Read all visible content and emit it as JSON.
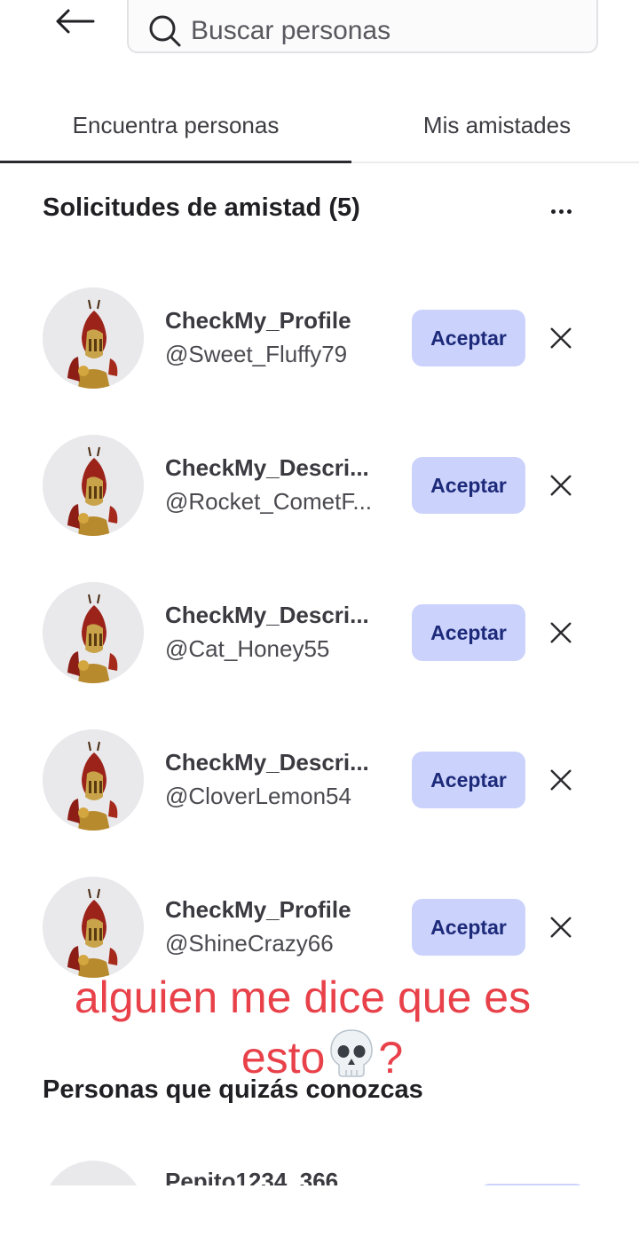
{
  "header": {
    "back_icon": "arrow-left-icon",
    "search": {
      "icon": "search-icon",
      "placeholder": "Buscar personas",
      "value": ""
    }
  },
  "tabs": [
    {
      "label": "Encuentra personas",
      "active": true
    },
    {
      "label": "Mis amistades",
      "active": false
    }
  ],
  "requests": {
    "title": "Solicitudes de amistad (5)",
    "more_icon": "more-horizontal-icon",
    "accept_label": "Aceptar",
    "dismiss_icon": "close-icon",
    "items": [
      {
        "name": "CheckMy_Profile",
        "handle": "@Sweet_Fluffy79"
      },
      {
        "name": "CheckMy_Descri...",
        "handle": "@Rocket_CometF..."
      },
      {
        "name": "CheckMy_Descri...",
        "handle": "@Cat_Honey55"
      },
      {
        "name": "CheckMy_Descri...",
        "handle": "@CloverLemon54"
      },
      {
        "name": "CheckMy_Profile",
        "handle": "@ShineCrazy66"
      }
    ]
  },
  "suggestions": {
    "title": "Personas que quizás conozcas",
    "items": [
      {
        "name": "Pepito1234_366"
      }
    ]
  },
  "overlay_caption": {
    "line1": "alguien me dice que es",
    "line2_before": "esto",
    "emoji": "skull-emoji",
    "line2_after": "?"
  },
  "colors": {
    "accept_bg": "#cbd2fb",
    "accept_text": "#1d2a7a",
    "caption": "#e8414a"
  }
}
